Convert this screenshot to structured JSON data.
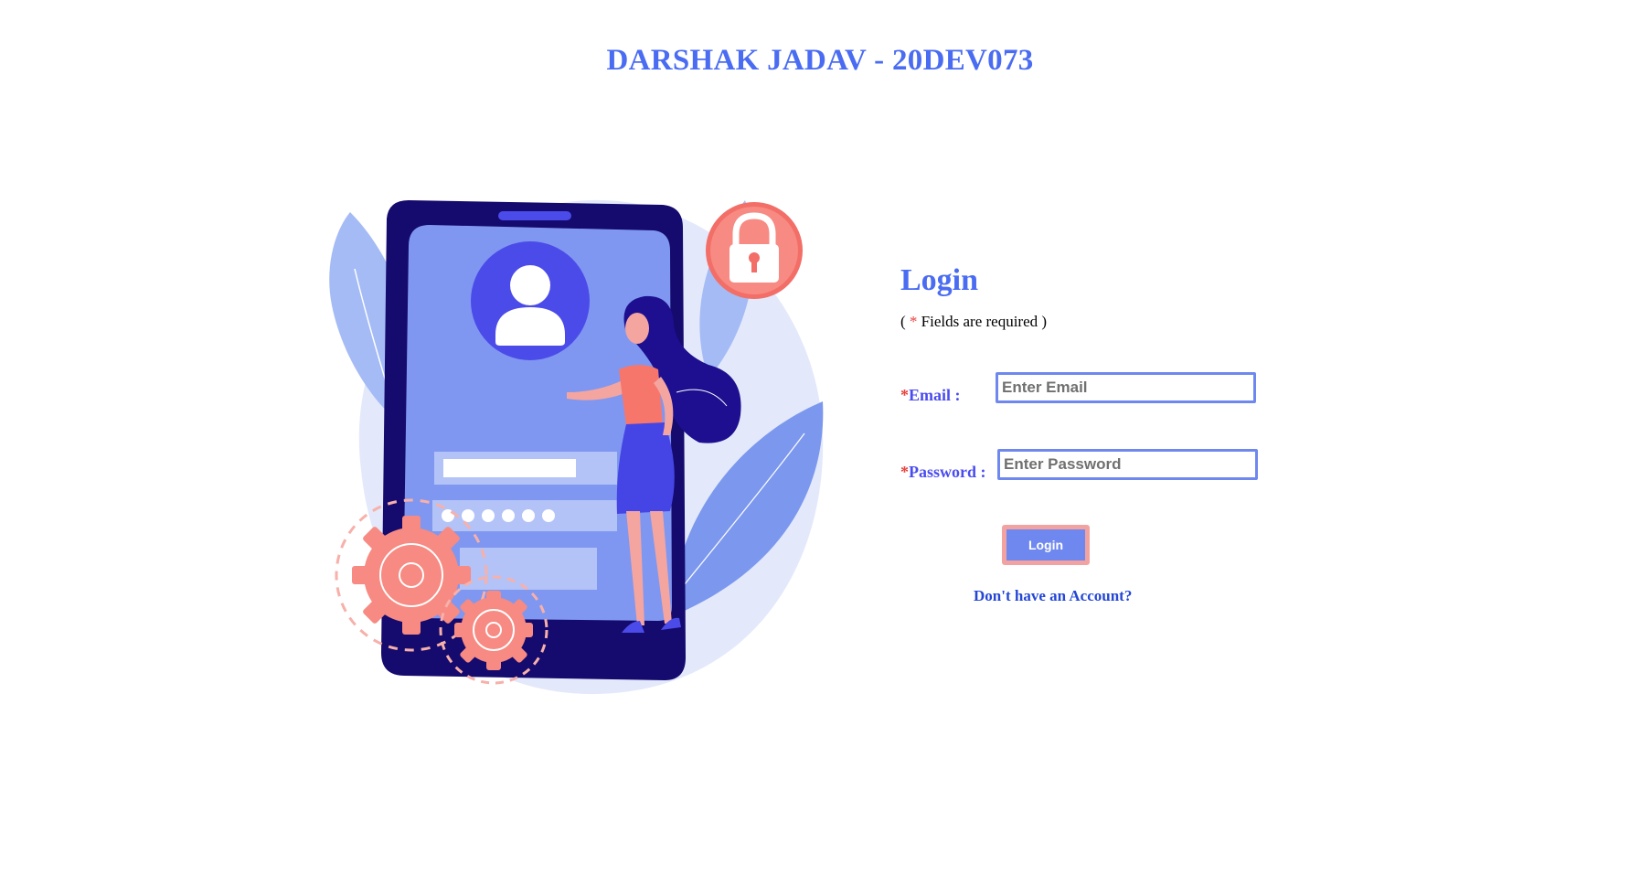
{
  "header": {
    "title": "DARSHAK JADAV - 20DEV073"
  },
  "login": {
    "heading": "Login",
    "note_open": "( ",
    "note_star": "*",
    "note_text": " Fields are required )",
    "email_star": "*",
    "email_label": "Email :",
    "email_placeholder": "Enter Email",
    "email_value": "",
    "password_star": "*",
    "password_label": "Password :",
    "password_placeholder": "Enter Password",
    "password_value": "",
    "button_label": "Login",
    "signup_link": "Don't have an Account?"
  },
  "colors": {
    "accent": "#4a6cf2",
    "required": "#e8413c",
    "button": "#6f88ef",
    "button_border": "#f3a2a2"
  }
}
